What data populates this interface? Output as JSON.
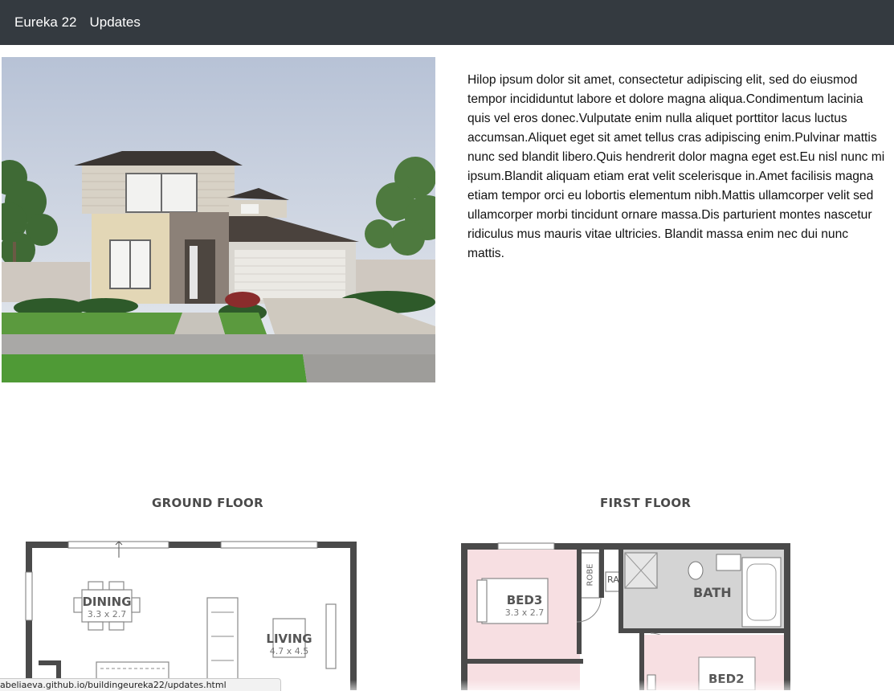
{
  "nav": {
    "brand": "Eureka 22",
    "links": [
      "Updates"
    ]
  },
  "hero_image": {
    "description_icon": "house-render-image"
  },
  "content": {
    "paragraph": "Hilop ipsum dolor sit amet, consectetur adipiscing elit, sed do eiusmod tempor incididuntut labore et dolore magna aliqua.Condimentum lacinia quis vel eros donec.Vulputate enim nulla aliquet porttitor lacus luctus accumsan.Aliquet eget sit amet tellus cras adipiscing enim.Pulvinar mattis nunc sed blandit libero.Quis hendrerit dolor magna eget est.Eu nisl nunc mi ipsum.Blandit aliquam etiam erat velit scelerisque in.Amet facilisis magna etiam tempor orci eu lobortis elementum nibh.Mattis ullamcorper velit sed ullamcorper morbi tincidunt ornare massa.Dis parturient montes nascetur ridiculus mus mauris vitae ultricies. Blandit massa enim nec dui nunc mattis."
  },
  "floorplans": {
    "ground": {
      "title": "GROUND FLOOR",
      "rooms": [
        {
          "name": "DINING",
          "size": "3.3 x 2.7"
        },
        {
          "name": "LIVING",
          "size": "4.7 x 4.5"
        }
      ]
    },
    "first": {
      "title": "FIRST FLOOR",
      "rooms": [
        {
          "name": "BED3",
          "size": "3.3 x 2.7"
        },
        {
          "name": "BATH",
          "size": ""
        },
        {
          "name": "BED2",
          "size": ""
        }
      ],
      "labels": {
        "robe": "ROBE",
        "ra": "RA"
      }
    }
  },
  "statusbar": {
    "url": "abeliaeva.github.io/buildingeureka22/updates.html"
  },
  "colors": {
    "navbar": "#343a40",
    "bedroom_fill": "#f7dfe2",
    "bath_fill": "#d4d4d4",
    "wall": "#4a4a4a"
  }
}
